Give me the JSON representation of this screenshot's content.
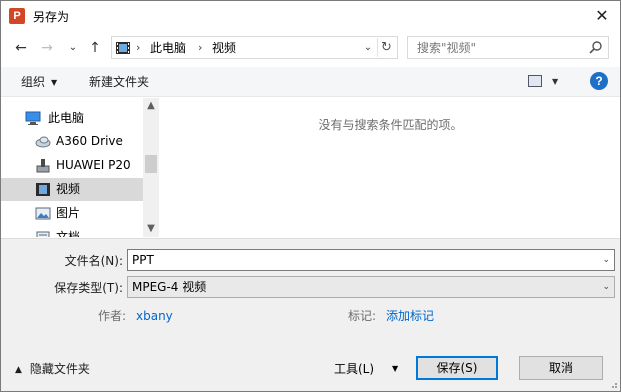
{
  "titlebar": {
    "app_icon": "P",
    "title": "另存为",
    "close": "✕"
  },
  "nav": {
    "back": "←",
    "forward": "→",
    "recent": "⌄",
    "up": "↑",
    "breadcrumb": [
      "此电脑",
      "视频"
    ],
    "separator": "›",
    "search_placeholder": "搜索\"视频\""
  },
  "toolbar": {
    "organize": "组织",
    "new_folder": "新建文件夹",
    "help": "?"
  },
  "tree": {
    "items": [
      {
        "label": "此电脑",
        "icon": "computer-icon"
      },
      {
        "label": "A360 Drive",
        "icon": "cloud-drive-icon"
      },
      {
        "label": "HUAWEI P20",
        "icon": "phone-icon"
      },
      {
        "label": "视频",
        "icon": "video-folder-icon",
        "selected": true
      },
      {
        "label": "图片",
        "icon": "pictures-folder-icon"
      },
      {
        "label": "文档",
        "icon": "documents-folder-icon"
      }
    ]
  },
  "files": {
    "empty_message": "没有与搜索条件匹配的项。"
  },
  "form": {
    "filename_label": "文件名(N):",
    "filename_value": "PPT",
    "filetype_label": "保存类型(T):",
    "filetype_value": "MPEG-4 视频",
    "author_label": "作者:",
    "author_value": "xbany",
    "tags_label": "标记:",
    "tags_value": "添加标记"
  },
  "footer": {
    "hide_folders": "隐藏文件夹",
    "tools": "工具(L)",
    "save": "保存(S)",
    "cancel": "取消"
  }
}
